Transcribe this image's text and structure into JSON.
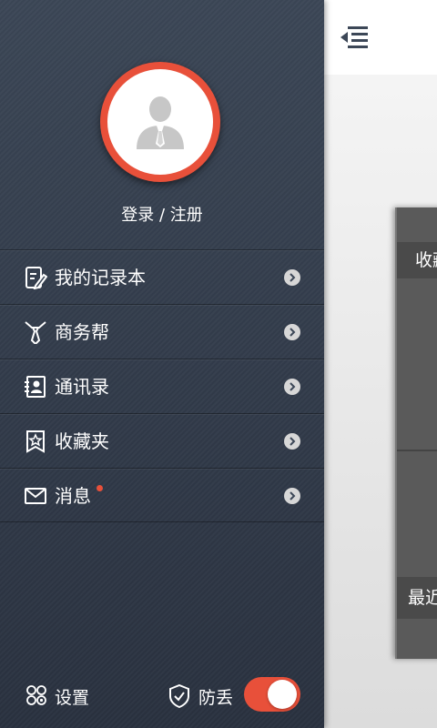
{
  "profile": {
    "login_register": "登录 / 注册"
  },
  "menu": {
    "items": [
      {
        "label": "我的记录本",
        "icon": "notebook-edit-icon"
      },
      {
        "label": "商务帮",
        "icon": "tie-icon"
      },
      {
        "label": "通讯录",
        "icon": "contacts-icon"
      },
      {
        "label": "收藏夹",
        "icon": "star-bookmark-icon"
      },
      {
        "label": "消息",
        "icon": "mail-icon",
        "unread_dot": true
      }
    ]
  },
  "footer": {
    "settings_label": "设置",
    "anti_loss_label": "防丢",
    "anti_loss_enabled": true
  },
  "background_panel": {
    "section_favorites": "收藏",
    "section_recent": "最近"
  },
  "colors": {
    "accent": "#e8503a",
    "drawer_top": "#3c4757",
    "drawer_bottom": "#2a3240"
  }
}
